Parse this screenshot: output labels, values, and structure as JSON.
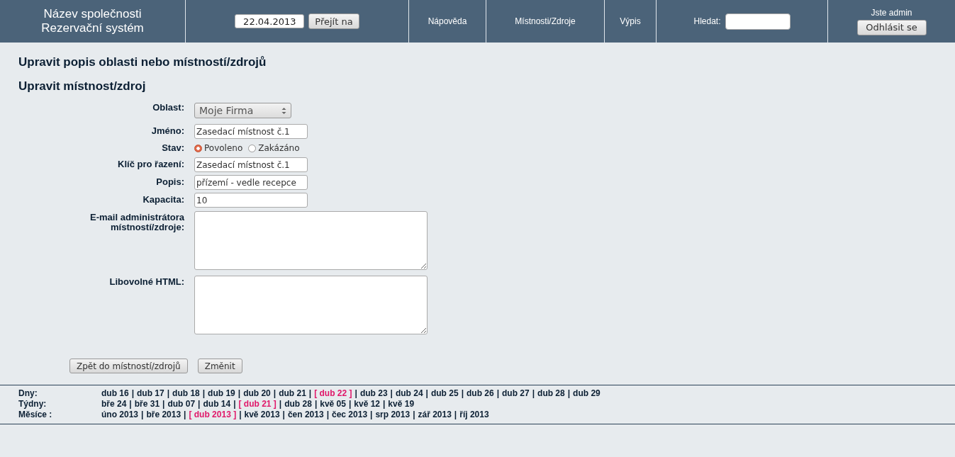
{
  "header": {
    "company": "Název společnosti",
    "system": "Rezervační systém",
    "date_field": {
      "value": "22.04.2013"
    },
    "goto_button": "Přejít na",
    "nav_links": [
      "Nápověda",
      "Místnosti/Zdroje",
      "Výpis"
    ],
    "search": {
      "label": "Hledat:"
    },
    "user": "Jste admin",
    "logout_button": "Odhlásit se"
  },
  "page_title": "Upravit popis oblasti nebo místností/zdrojů",
  "section_title": "Upravit místnost/zdroj",
  "form": [
    {
      "kind": "select",
      "label": "Oblast:",
      "value": "Moje Firma"
    },
    {
      "kind": "text",
      "label": "Jméno:",
      "value": "Zasedací místnost č.1"
    },
    {
      "kind": "radio",
      "label": "Stav:",
      "options": [
        {
          "label": "Povoleno",
          "selected": true
        },
        {
          "label": "Zakázáno",
          "selected": false
        }
      ]
    },
    {
      "kind": "text",
      "label": "Klíč pro řazení:",
      "value": "Zasedací místnost č.1"
    },
    {
      "kind": "text",
      "label": "Popis:",
      "value": "přízemí - vedle recepce"
    },
    {
      "kind": "text",
      "label": "Kapacita:",
      "value": "10"
    },
    {
      "kind": "textarea",
      "label": "E-mail administrátora místností/zdroje:"
    },
    {
      "kind": "textarea",
      "label": "Libovolné HTML:"
    }
  ],
  "buttons": [
    "Zpět do místností/zdrojů",
    "Změnit"
  ],
  "date_nav": [
    {
      "label": "Dny:",
      "separator": "|",
      "items": [
        {
          "label": "dub 16",
          "selected": false
        },
        {
          "label": "dub 17",
          "selected": false
        },
        {
          "label": "dub 18",
          "selected": false
        },
        {
          "label": "dub 19",
          "selected": false
        },
        {
          "label": "dub 20",
          "selected": false
        },
        {
          "label": "dub 21",
          "selected": false
        },
        {
          "label": "[ dub 22 ]",
          "selected": true
        },
        {
          "label": "dub 23",
          "selected": false
        },
        {
          "label": "dub 24",
          "selected": false
        },
        {
          "label": "dub 25",
          "selected": false
        },
        {
          "label": "dub 26",
          "selected": false
        },
        {
          "label": "dub 27",
          "selected": false
        },
        {
          "label": "dub 28",
          "selected": false
        },
        {
          "label": "dub 29",
          "selected": false
        }
      ]
    },
    {
      "label": "Týdny:",
      "separator": "|",
      "items": [
        {
          "label": "bře 24",
          "selected": false
        },
        {
          "label": "bře 31",
          "selected": false
        },
        {
          "label": "dub 07",
          "selected": false
        },
        {
          "label": "dub 14",
          "selected": false
        },
        {
          "label": "[ dub 21 ]",
          "selected": true
        },
        {
          "label": "dub 28",
          "selected": false
        },
        {
          "label": "kvě 05",
          "selected": false
        },
        {
          "label": "kvě 12",
          "selected": false
        },
        {
          "label": "kvě 19",
          "selected": false
        }
      ]
    },
    {
      "label": "Měsíce :",
      "separator": "|",
      "items": [
        {
          "label": "úno 2013",
          "selected": false
        },
        {
          "label": "bře 2013",
          "selected": false
        },
        {
          "label": "[ dub 2013 ]",
          "selected": true
        },
        {
          "label": "kvě 2013",
          "selected": false
        },
        {
          "label": "čen 2013",
          "selected": false
        },
        {
          "label": "čec 2013",
          "selected": false
        },
        {
          "label": "srp 2013",
          "selected": false
        },
        {
          "label": "zář 2013",
          "selected": false
        },
        {
          "label": "říj 2013",
          "selected": false
        }
      ]
    }
  ]
}
